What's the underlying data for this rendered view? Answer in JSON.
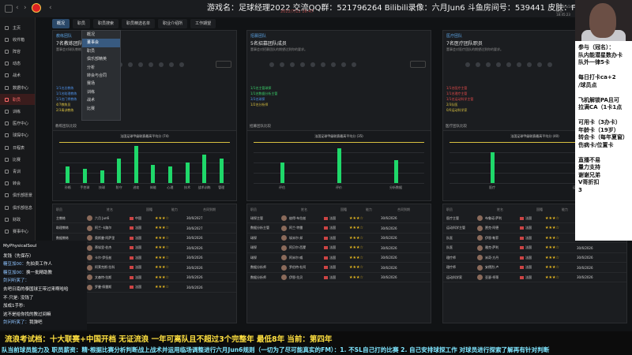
{
  "top": {
    "title": "游戏名：足球经理2022  交流QQ群：521796264 Bilibili录像：六月Jun6  斗鱼房间号：539441 皮肤：FLAYUS",
    "subtitle": "2022/7/12 16:47",
    "right_info": "2024/5/24 周五 18:45:23"
  },
  "sidebar": {
    "items": [
      {
        "label": "主页",
        "icon": "home-icon"
      },
      {
        "label": "收件箱",
        "icon": "inbox-icon"
      },
      {
        "label": "阵容",
        "icon": "squad-icon"
      },
      {
        "label": "动态",
        "icon": "dynamics-icon"
      },
      {
        "label": "战术",
        "icon": "tactics-icon"
      },
      {
        "label": "数据中心",
        "icon": "data-icon"
      },
      {
        "label": "职员",
        "icon": "staff-icon",
        "active": true
      },
      {
        "label": "训练",
        "icon": "training-icon"
      },
      {
        "label": "医疗中心",
        "icon": "medical-icon"
      },
      {
        "label": "球探中心",
        "icon": "scout-icon"
      },
      {
        "label": "日程表",
        "icon": "calendar-icon"
      },
      {
        "label": "比赛",
        "icon": "match-icon"
      },
      {
        "label": "青训",
        "icon": "youth-icon"
      },
      {
        "label": "转会",
        "icon": "transfer-icon"
      },
      {
        "label": "俱乐部愿景",
        "icon": "vision-icon"
      },
      {
        "label": "俱乐部信息",
        "icon": "info-icon"
      },
      {
        "label": "财政",
        "icon": "finance-icon"
      },
      {
        "label": "赛事中心",
        "icon": "competition-icon"
      }
    ]
  },
  "tabs": [
    {
      "label": "概况",
      "active": true
    },
    {
      "label": "职员"
    },
    {
      "label": "职员搜索"
    },
    {
      "label": "职员精选名单"
    },
    {
      "label": "职业介绍所"
    },
    {
      "label": "工作期望"
    }
  ],
  "menu": {
    "items": [
      "概况",
      "董事会",
      "职员",
      "俱乐部精英",
      "分析",
      "转会与合同",
      "赛场",
      "训练",
      "战术",
      "比赛"
    ],
    "selected_index": 1
  },
  "panels": [
    {
      "title": "教练团队",
      "subtitle": "7名教练团队职员",
      "desc": "董事会对球队教练团队的期望达到你的要求。",
      "bullets": [
        {
          "text": "1/1名总教练",
          "color": "b"
        },
        {
          "text": "1/1名助理教练",
          "color": "b"
        },
        {
          "text": "1/1名门将教练",
          "color": "b"
        },
        {
          "text": "4/7教练员",
          "color": "y"
        },
        {
          "text": "2/3青训教练",
          "color": "y"
        }
      ],
      "section": "教练团队比较",
      "chart_title": "法国足球甲级联赛最高平均分 (74)",
      "chart_labels": [
        "孙格",
        "手控球",
        "技球",
        "防守",
        "进攻",
        "体能",
        "心理",
        "技术",
        "战术训练",
        "管理"
      ]
    },
    {
      "title": "招募团队",
      "subtitle": "5名招募团队成员",
      "desc": "董事会对招募团队的期望达到你的要求。",
      "bullets": [
        {
          "text": "1/1名主管球探",
          "color": "g"
        },
        {
          "text": "1/1名数据分析主管",
          "color": "g"
        },
        {
          "text": "3/3名球探",
          "color": "b"
        },
        {
          "text": "1/2名分析师",
          "color": "y"
        }
      ],
      "section": "招募团队比较",
      "chart_title": "法国足球甲级联赛最高平均分 (35)",
      "chart_labels": [
        "评估",
        "评价",
        "分析数据"
      ]
    },
    {
      "title": "医疗团队",
      "subtitle": "7名医疗团队职员",
      "desc": "董事会对医疗团队的期望达到你的要求。",
      "bullets": [
        {
          "text": "1/1名医疗主管",
          "color": "r"
        },
        {
          "text": "1/1名理疗主管",
          "color": "r"
        },
        {
          "text": "1/1名运动科学主管",
          "color": "r"
        },
        {
          "text": "2/3队医",
          "color": "y"
        },
        {
          "text": "0/0运动科学家",
          "color": "y"
        }
      ],
      "section": "医疗团队比较",
      "chart_title": "法国足球甲级联赛最高平均分 (40)",
      "chart_labels": [
        "医疗",
        "运动学"
      ]
    }
  ],
  "chart_data": [
    {
      "type": "bar",
      "title": "法国足球甲级联赛最高平均分 (74)",
      "categories": [
        "孙格",
        "手控球",
        "技球",
        "防守",
        "进攻",
        "体能",
        "心理",
        "技术",
        "战术训练",
        "管理"
      ],
      "values": [
        8,
        7,
        6,
        12,
        18,
        9,
        8,
        10,
        14,
        12
      ],
      "ylim": [
        0,
        20
      ]
    },
    {
      "type": "bar",
      "title": "法国足球甲级联赛最高平均分 (35)",
      "categories": [
        "评估",
        "评价",
        "分析数据"
      ],
      "values": [
        10,
        17,
        11
      ],
      "ylim": [
        0,
        20
      ]
    },
    {
      "type": "bar",
      "title": "法国足球甲级联赛最高平均分 (40)",
      "categories": [
        "医疗",
        "运动学"
      ],
      "values": [
        15,
        13
      ],
      "ylim": [
        0,
        20
      ]
    }
  ],
  "staff_tables": [
    {
      "headers": [
        "职员",
        "",
        "姓名",
        "国籍",
        "能力",
        "合同到期"
      ],
      "rows": [
        {
          "role": "主教练",
          "name": "六月 Jun6",
          "nation": "中国",
          "contract": "30/6/2027"
        },
        {
          "role": "助理教练",
          "name": "阿兰·卡路尔",
          "nation": "法国",
          "contract": "30/6/2027"
        },
        {
          "role": "数据教练",
          "name": "奥斯曼·阿萨里",
          "nation": "法国",
          "contract": "30/6/2026"
        },
        {
          "role": "门将教练",
          "name": "蒂埃里·伯杰",
          "nation": "法国",
          "contract": "30/6/2026"
        },
        {
          "role": "教练员",
          "name": "卡尔·伊伍兹",
          "nation": "法国",
          "contract": "30/6/2026"
        },
        {
          "role": "教练员",
          "name": "阿莱克斯·拉科",
          "nation": "法国",
          "contract": "30/6/2026"
        },
        {
          "role": "教练员",
          "name": "文森特·拉斯",
          "nation": "法国",
          "contract": "30/6/2026"
        },
        {
          "role": "青训主管",
          "name": "罗曼·佩雷斯",
          "nation": "法国",
          "contract": "30/6/2026"
        }
      ]
    },
    {
      "headers": [
        "职员",
        "",
        "姓名",
        "国籍",
        "能力",
        "合同到期"
      ],
      "rows": [
        {
          "role": "球探主管",
          "name": "彼得·布拉兹",
          "nation": "法国",
          "contract": "30/6/2026"
        },
        {
          "role": "数据分析主管",
          "name": "阿兰·特雷",
          "nation": "法国",
          "contract": "30/6/2026"
        },
        {
          "role": "球探",
          "name": "埃米尔·邦",
          "nation": "法国",
          "contract": "30/6/2026"
        },
        {
          "role": "球探",
          "name": "阿贝尔·西蒙",
          "nation": "法国",
          "contract": "30/6/2026"
        },
        {
          "role": "球探",
          "name": "阿米尔·威",
          "nation": "法国",
          "contract": "30/6/2026"
        },
        {
          "role": "数据分析师",
          "name": "罗伯特·杜阿",
          "nation": "法国",
          "contract": "30/6/2026"
        },
        {
          "role": "数据分析师",
          "name": "伊恩·拉贝",
          "nation": "法国",
          "contract": "30/6/2026"
        }
      ]
    },
    {
      "headers": [
        "职员",
        "",
        "姓名",
        "国籍",
        "能力",
        "合同到期"
      ],
      "rows": [
        {
          "role": "医疗主管",
          "name": "布鲁诺·萨利",
          "nation": "法国",
          "contract": "30/6/2026"
        },
        {
          "role": "运动科学主管",
          "name": "贾克·阿德",
          "nation": "法国",
          "contract": "30/6/2026"
        },
        {
          "role": "队医",
          "name": "伊恩·勒菲",
          "nation": "法国",
          "contract": "30/6/2026"
        },
        {
          "role": "队医",
          "name": "雅克·萨利",
          "nation": "法国",
          "contract": "30/6/2026"
        },
        {
          "role": "理疗师",
          "name": "米奇·方丹",
          "nation": "法国",
          "contract": "30/6/2026"
        },
        {
          "role": "理疗师",
          "name": "安德烈·卢",
          "nation": "法国",
          "contract": "30/6/2026"
        },
        {
          "role": "运动科学家",
          "name": "亚瑟·柯蒂",
          "nation": "法国",
          "contract": "30/6/2026"
        }
      ]
    }
  ],
  "stream_right": [
    "参与（冠名）：",
    "队内能潜星数办卡",
    "队外一律5卡",
    "",
    "每日打卡ca+2",
    "/球员点",
    "",
    "飞机解锁PA且可",
    "拉满CA（1卡1点",
    "",
    "可用卡（3办卡）",
    "年龄卡（19岁）",
    "转会卡（每年夏窗）",
    "伤病卡/位置卡",
    "",
    "直播不易",
    "量力支持",
    "谢谢兄弟",
    "V哥折扣",
    "3"
  ],
  "chat": [
    {
      "name": "",
      "msg": "MyPhysicalSoul"
    },
    {
      "name": "",
      "msg": "发钱（先保存）"
    },
    {
      "name": "糖豆加00：",
      "msg": "先拍卖工作人"
    },
    {
      "name": "糖豆加00：",
      "msg": "换一批精助教"
    },
    {
      "name": "剑问听笑了：",
      "msg": ""
    },
    {
      "name": "",
      "msg": "去吧日南的泰国球王带过来啊哈哈"
    },
    {
      "name": "",
      "msg": "不·只是: 没钱了"
    },
    {
      "name": "",
      "msg": "加成1手秒:"
    },
    {
      "name": "",
      "msg": "这不是给你找的教过间嘛"
    },
    {
      "name": "剑问听笑了：",
      "msg": "我弹吧"
    }
  ],
  "banner": {
    "line1": "流浪考试档：十大联赛+中国开档 无证流浪  一年可离队且不超过3个完整年 最低8年  当前：第四年",
    "line2": "队当前球员能力及 职员薪资：精·根据比赛分析判断战上战术并运用临场调整进行六月Jun6规则（一切为了尽可能真实的FM）：1. 不SL自己打的比赛  2. 自己安排球探工作 对球员进行探索了解再有针对判断"
  }
}
